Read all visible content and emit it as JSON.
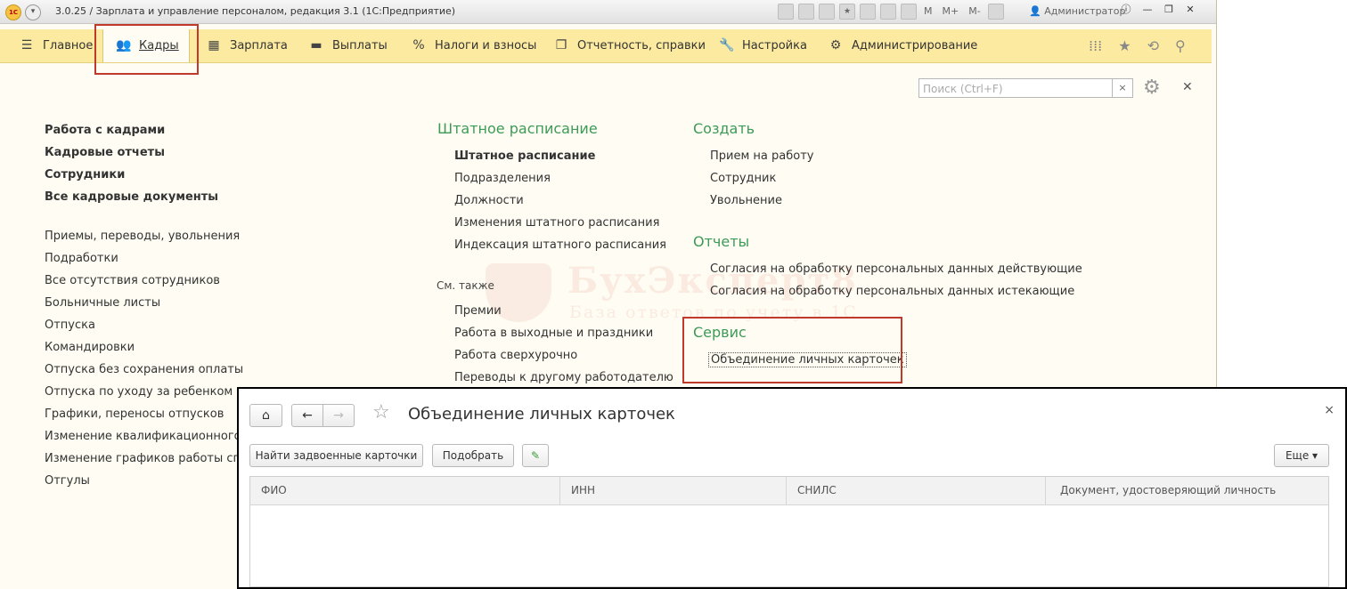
{
  "window": {
    "title": "3.0.25 / Зарплата и управление персоналом, редакция 3.1  (1С:Предприятие)",
    "logo": "1С",
    "user": "Администратор",
    "toolbar_text": [
      "M",
      "M+",
      "M-"
    ]
  },
  "navbar": {
    "items": [
      {
        "label": "Главное",
        "icon": "hamburger-icon"
      },
      {
        "label": "Кадры",
        "icon": "people-icon"
      },
      {
        "label": "Зарплата",
        "icon": "calculator-icon"
      },
      {
        "label": "Выплаты",
        "icon": "wallet-icon"
      },
      {
        "label": "Налоги и взносы",
        "icon": "percent-icon"
      },
      {
        "label": "Отчетность, справки",
        "icon": "reports-icon"
      },
      {
        "label": "Настройка",
        "icon": "wrench-icon"
      },
      {
        "label": "Администрирование",
        "icon": "gear-icon"
      }
    ],
    "active": "Кадры"
  },
  "panel": {
    "search_placeholder": "Поиск (Ctrl+F)",
    "left_bold": [
      "Работа с кадрами",
      "Кадровые отчеты",
      "Сотрудники",
      "Все кадровые документы"
    ],
    "left_regular": [
      "Приемы, переводы, увольнения",
      "Подработки",
      "Все отсутствия сотрудников",
      "Больничные листы",
      "Отпуска",
      "Командировки",
      "Отпуска без сохранения оплаты",
      "Отпуска по уходу за ребенком",
      "Графики, переносы отпусков",
      "Изменение квалификационного раз",
      "Изменение графиков работы списк",
      "Отгулы"
    ],
    "staffing": {
      "title": "Штатное расписание",
      "items": [
        "Штатное расписание",
        "Подразделения",
        "Должности",
        "Изменения штатного расписания",
        "Индексация штатного расписания"
      ]
    },
    "see_also": {
      "title": "См. также",
      "items": [
        "Премии",
        "Работа в выходные и праздники",
        "Работа сверхурочно",
        "Переводы к другому работодателю"
      ]
    },
    "create": {
      "title": "Создать",
      "items": [
        "Прием на работу",
        "Сотрудник",
        "Увольнение"
      ]
    },
    "reports": {
      "title": "Отчеты",
      "items": [
        "Согласия на обработку персональных данных действующие",
        "Согласия на обработку персональных данных истекающие"
      ]
    },
    "service": {
      "title": "Сервис",
      "items": [
        "Объединение личных карточек"
      ]
    },
    "watermark": {
      "title": "БухЭксперт8",
      "subtitle": "База ответов по учету в 1С"
    }
  },
  "dialog": {
    "title": "Объединение личных карточек",
    "buttons": {
      "find": "Найти задвоенные карточки",
      "pick": "Подобрать",
      "more": "Еще"
    },
    "columns": [
      "ФИО",
      "ИНН",
      "СНИЛС",
      "Документ, удостоверяющий личность"
    ]
  }
}
